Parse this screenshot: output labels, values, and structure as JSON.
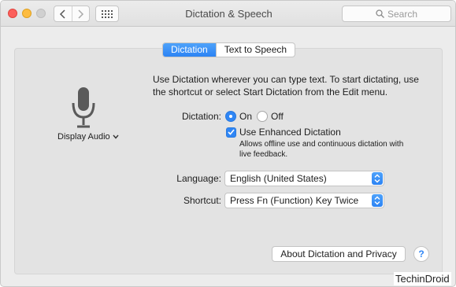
{
  "window": {
    "title": "Dictation & Speech"
  },
  "search": {
    "placeholder": "Search"
  },
  "tabs": [
    {
      "label": "Dictation",
      "active": true
    },
    {
      "label": "Text to Speech",
      "active": false
    }
  ],
  "mic": {
    "source_label": "Display Audio"
  },
  "description": "Use Dictation wherever you can type text. To start dictating, use the shortcut or select Start Dictation from the Edit menu.",
  "dictation": {
    "label": "Dictation:",
    "on_label": "On",
    "off_label": "Off",
    "selected": "On",
    "enhanced_label": "Use Enhanced Dictation",
    "enhanced_checked": true,
    "enhanced_note": "Allows offline use and continuous dictation with live feedback."
  },
  "language": {
    "label": "Language:",
    "value": "English (United States)"
  },
  "shortcut": {
    "label": "Shortcut:",
    "value": "Press Fn (Function) Key Twice"
  },
  "about_button": "About Dictation and Privacy",
  "help_label": "?",
  "watermark": "TechinDroid",
  "colors": {
    "accent": "#2f86f5",
    "close": "#fc605c",
    "minimize": "#fdbc40"
  }
}
